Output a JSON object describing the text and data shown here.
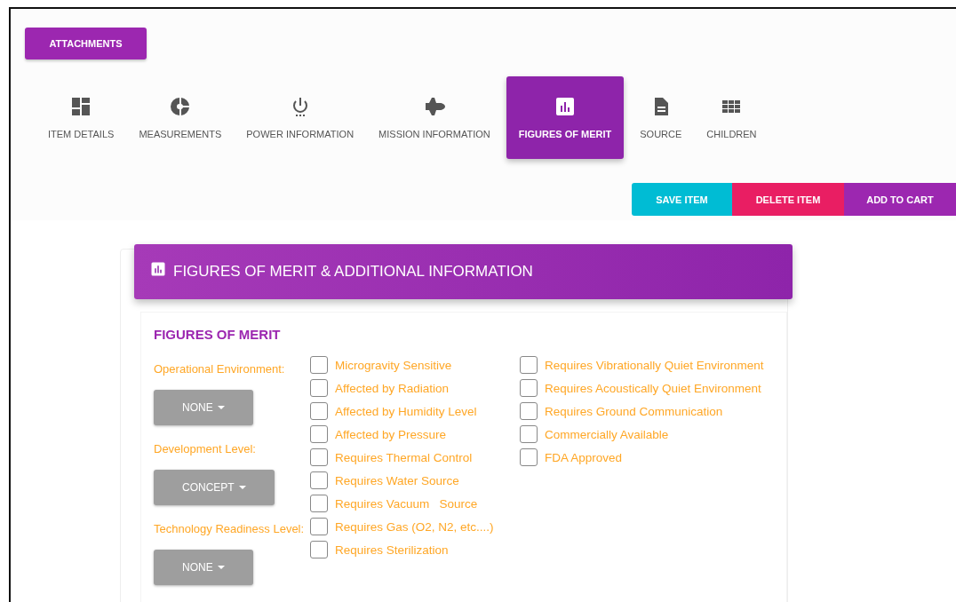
{
  "attachments_button": "ATTACHMENTS",
  "tabs": [
    {
      "label": "ITEM DETAILS",
      "kind": "dashboard",
      "selected": false
    },
    {
      "label": "MEASUREMENTS",
      "kind": "pie",
      "selected": false
    },
    {
      "label": "POWER INFORMATION",
      "kind": "power",
      "selected": false
    },
    {
      "label": "MISSION INFORMATION",
      "kind": "shuttle",
      "selected": false
    },
    {
      "label": "FIGURES OF MERIT",
      "kind": "chart",
      "selected": true
    },
    {
      "label": "SOURCE",
      "kind": "document",
      "selected": false
    },
    {
      "label": "CHILDREN",
      "kind": "grid",
      "selected": false
    }
  ],
  "actions": [
    {
      "label": "SAVE ITEM",
      "kind": "save"
    },
    {
      "label": "DELETE ITEM",
      "kind": "delete"
    },
    {
      "label": "ADD TO CART",
      "kind": "cart"
    }
  ],
  "card": {
    "title": "FIGURES OF MERIT & ADDITIONAL INFORMATION",
    "section_title": "FIGURES OF MERIT",
    "fields": [
      {
        "label": "Operational Environment:",
        "value": "NONE"
      },
      {
        "label": "Development Level:",
        "value": "CONCEPT"
      },
      {
        "label": "Technology Readiness Level:",
        "value": "NONE"
      }
    ],
    "checkbox_columns": [
      [
        {
          "label": "Microgravity Sensitive",
          "checked": false
        },
        {
          "label": "Affected by Radiation",
          "checked": false
        },
        {
          "label": "Affected by Humidity Level",
          "checked": false
        },
        {
          "label": "Affected by Pressure",
          "checked": false
        },
        {
          "label": "Requires Thermal Control",
          "checked": false
        },
        {
          "label": "Requires Water Source",
          "checked": false
        },
        {
          "label": "Requires Vacuum   Source",
          "checked": false
        },
        {
          "label": "Requires Gas (O2, N2, etc....)",
          "checked": false
        },
        {
          "label": "Requires Sterilization",
          "checked": false
        }
      ],
      [
        {
          "label": "Requires Vibrationally Quiet Environment",
          "checked": false
        },
        {
          "label": "Requires Acoustically Quiet Environment",
          "checked": false
        },
        {
          "label": "Requires Ground Communication",
          "checked": false
        },
        {
          "label": "Commercially Available",
          "checked": false
        },
        {
          "label": "FDA Approved",
          "checked": false
        }
      ]
    ]
  }
}
